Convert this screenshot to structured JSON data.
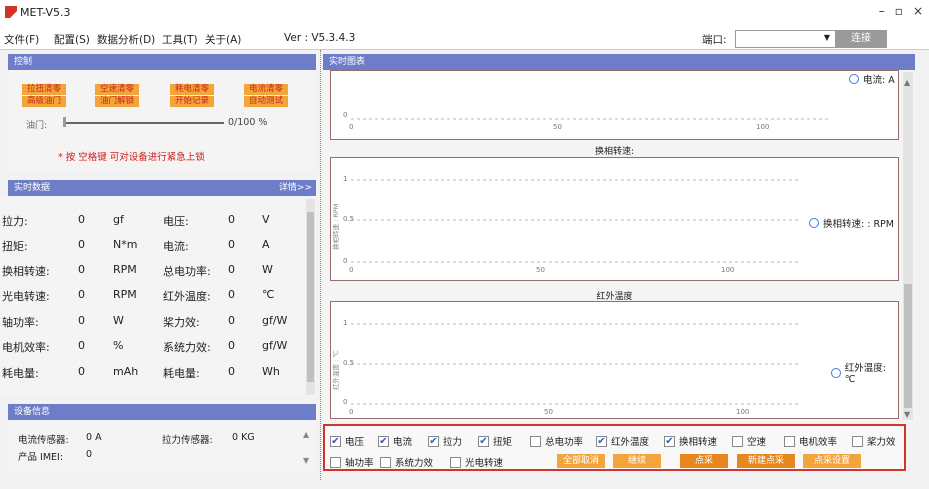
{
  "window": {
    "title": "MET-V5.3",
    "min": "–",
    "max": "▫",
    "close": "×"
  },
  "menu": {
    "file": "文件(F)",
    "config": "配置(S)",
    "analysis": "数据分析(D)",
    "tools": "工具(T)",
    "about": "关于(A)",
    "version": "Ver : V5.3.4.3",
    "port_label": "端口:",
    "port_value": "",
    "connect": "连接"
  },
  "control": {
    "header": "控制",
    "buttons": [
      "拉扭清零",
      "空速清零",
      "耗电清零",
      "电流清零",
      "高级油门",
      "油门解锁",
      "开始记录",
      "自动测试"
    ],
    "throttle_label": "油门:",
    "throttle_value": "0/100 %",
    "throttle_level": 0,
    "warning": "* 按 空格键 可对设备进行紧急上锁"
  },
  "realtime": {
    "header": "实时数据",
    "detail": "详情>>",
    "rows": [
      {
        "l1": "拉力:",
        "v1": "0",
        "u1": "gf",
        "l2": "电压:",
        "v2": "0",
        "u2": "V"
      },
      {
        "l1": "扭矩:",
        "v1": "0",
        "u1": "N*m",
        "l2": "电流:",
        "v2": "0",
        "u2": "A"
      },
      {
        "l1": "换相转速:",
        "v1": "0",
        "u1": "RPM",
        "l2": "总电功率:",
        "v2": "0",
        "u2": "W"
      },
      {
        "l1": "光电转速:",
        "v1": "0",
        "u1": "RPM",
        "l2": "红外温度:",
        "v2": "0",
        "u2": "℃"
      },
      {
        "l1": "轴功率:",
        "v1": "0",
        "u1": "W",
        "l2": "桨力效:",
        "v2": "0",
        "u2": "gf/W"
      },
      {
        "l1": "电机效率:",
        "v1": "0",
        "u1": "%",
        "l2": "系统力效:",
        "v2": "0",
        "u2": "gf/W"
      },
      {
        "l1": "耗电量:",
        "v1": "0",
        "u1": "mAh",
        "l2": "耗电量:",
        "v2": "0",
        "u2": "Wh"
      }
    ]
  },
  "device": {
    "header": "设备信息",
    "current_sensor_label": "电流传感器:",
    "current_sensor_value": "0 A",
    "pull_sensor_label": "拉力传感器:",
    "pull_sensor_value": "0 KG",
    "imei_label": "产品 IMEI:",
    "imei_value": "0"
  },
  "charts": {
    "header": "实时图表",
    "chart1": {
      "legend": "电流: A",
      "ticks": [
        "0",
        "50",
        "100"
      ],
      "y0": "0"
    },
    "chart2": {
      "title": "换相转速:",
      "legend": "换相转速: : RPM",
      "ylabel": "换相转速 : RPM",
      "yticks": [
        "1",
        "0.5",
        "0"
      ],
      "xticks": [
        "0",
        "50",
        "100"
      ]
    },
    "chart3": {
      "title": "红外温度",
      "legend": "红外温度: ℃",
      "ylabel": "红外温度 : ℃",
      "yticks": [
        "1",
        "0.5",
        "0"
      ],
      "xticks": [
        "0",
        "50",
        "100"
      ]
    }
  },
  "checks": [
    {
      "label": "电压",
      "on": true
    },
    {
      "label": "电流",
      "on": true
    },
    {
      "label": "拉力",
      "on": true
    },
    {
      "label": "扭矩",
      "on": true
    },
    {
      "label": "总电功率",
      "on": false
    },
    {
      "label": "红外温度",
      "on": true
    },
    {
      "label": "换相转速",
      "on": true
    },
    {
      "label": "空速",
      "on": false
    },
    {
      "label": "电机效率",
      "on": false
    },
    {
      "label": "桨力效",
      "on": false
    },
    {
      "label": "轴功率",
      "on": false
    },
    {
      "label": "系统力效",
      "on": false
    },
    {
      "label": "光电转速",
      "on": false
    }
  ],
  "actions": {
    "clear_all": "全部取消",
    "continue": "继续",
    "sample": "点采",
    "new_sample": "新建点采",
    "sample_settings": "点采设置"
  },
  "colors": {
    "header": "#6e7dc8",
    "orange": "#f3a43a",
    "accent_red": "#d2332b",
    "legend_blue": "#3a7de3"
  }
}
